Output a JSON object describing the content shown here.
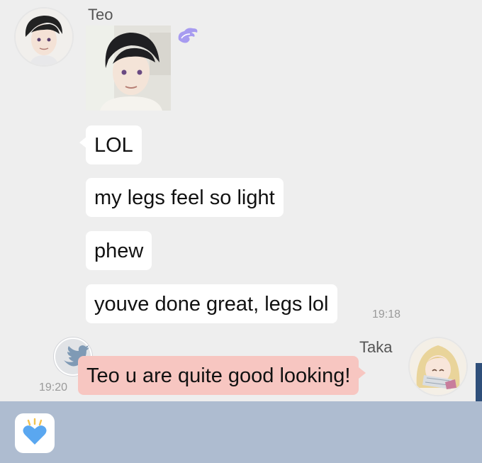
{
  "teo": {
    "name": "Teo",
    "messages": [
      "LOL",
      "my legs feel so light",
      "phew",
      "youve done great, legs lol"
    ],
    "time": "19:18"
  },
  "taka": {
    "name": "Taka",
    "message": "Teo u are quite good looking!",
    "time": "19:20"
  },
  "colors": {
    "background": "#eeeeee",
    "bubble_white": "#ffffff",
    "bubble_pink": "#f7c6c1",
    "input_bar": "#aebcd0",
    "heart_blue": "#5aa7f0"
  },
  "icons": {
    "teo_badge": "wing-icon",
    "taka_badge": "twitter-bird-icon",
    "input_button": "heart-icon"
  }
}
